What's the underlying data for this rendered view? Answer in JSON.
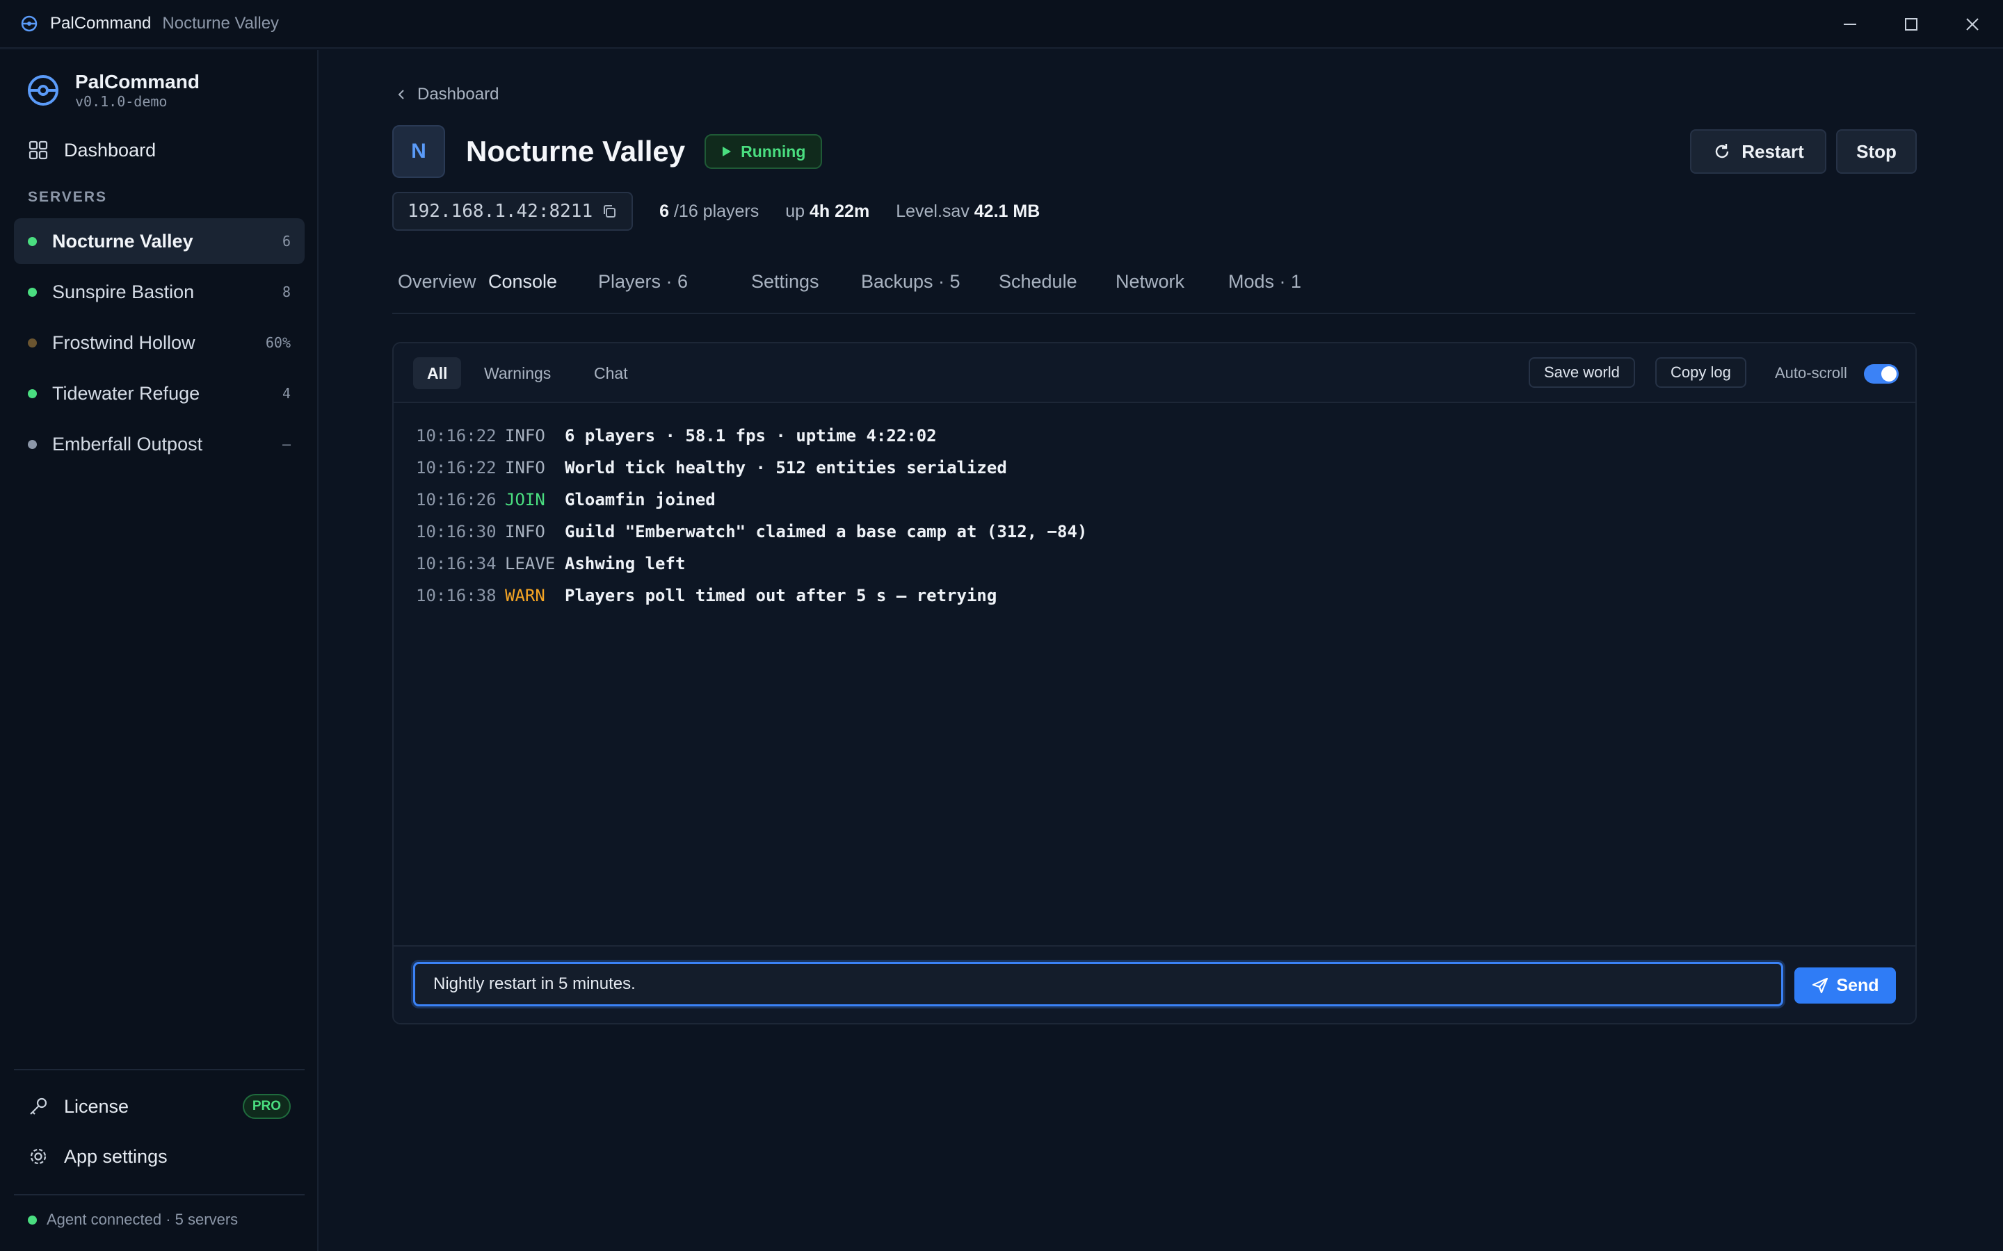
{
  "titlebar": {
    "app_name": "PalCommand",
    "window_name": "Nocturne Valley"
  },
  "sidebar": {
    "brand_name": "PalCommand",
    "version": "v0.1.0-demo",
    "dashboard_label": "Dashboard",
    "section_label": "SERVERS",
    "servers": [
      {
        "name": "Nocturne Valley",
        "count": "6",
        "status_color": "#4ade80",
        "active": true
      },
      {
        "name": "Sunspire Bastion",
        "count": "8",
        "status_color": "#4ade80",
        "active": false
      },
      {
        "name": "Frostwind Hollow",
        "count": "60%",
        "status_color": "#6b5530",
        "active": false
      },
      {
        "name": "Tidewater Refuge",
        "count": "4",
        "status_color": "#4ade80",
        "active": false
      },
      {
        "name": "Emberfall Outpost",
        "count": "–",
        "status_color": "#8c97a8",
        "active": false
      }
    ],
    "license_label": "License",
    "license_badge": "PRO",
    "settings_label": "App settings",
    "agent_status": "Agent connected · 5 servers"
  },
  "main": {
    "breadcrumb": "Dashboard",
    "avatar_letter": "N",
    "title": "Nocturne Valley",
    "status": "Running",
    "restart_label": "Restart",
    "stop_label": "Stop",
    "address": "192.168.1.42:8211",
    "players_current": "6",
    "players_max": "/16 players",
    "uptime_prefix": "up",
    "uptime": "4h 22m",
    "save_name": "Level.sav",
    "save_size": "42.1 MB",
    "tabs": [
      {
        "label": "Overview"
      },
      {
        "label": "Console"
      },
      {
        "label": "Players · 6"
      },
      {
        "label": "Settings"
      },
      {
        "label": "Backups · 5"
      },
      {
        "label": "Schedule"
      },
      {
        "label": "Network"
      },
      {
        "label": "Mods · 1"
      }
    ],
    "active_tab": "Console"
  },
  "console": {
    "filters": [
      "All",
      "Warnings",
      "Chat"
    ],
    "active_filter": "All",
    "save_world_label": "Save world",
    "copy_log_label": "Copy log",
    "autoscroll_label": "Auto-scroll",
    "autoscroll_on": true,
    "lines": [
      {
        "time": "10:16:22",
        "level": "INFO",
        "message": "6 players · 58.1 fps · uptime 4:22:02"
      },
      {
        "time": "10:16:22",
        "level": "INFO",
        "message": "World tick healthy · 512 entities serialized"
      },
      {
        "time": "10:16:26",
        "level": "JOIN",
        "message": "Gloamfin joined"
      },
      {
        "time": "10:16:30",
        "level": "INFO",
        "message": "Guild \"Emberwatch\" claimed a base camp at (312, −84)"
      },
      {
        "time": "10:16:34",
        "level": "LEAVE",
        "message": "Ashwing left"
      },
      {
        "time": "10:16:38",
        "level": "WARN",
        "message": "Players poll timed out after 5 s — retrying"
      }
    ],
    "level_colors": {
      "INFO": "#a9b3c1",
      "JOIN": "#4ade80",
      "LEAVE": "#a9b3c1",
      "WARN": "#f5a524"
    },
    "input_value": "Nightly restart in 5 minutes.",
    "send_label": "Send"
  },
  "colors": {
    "accent": "#3b82f6",
    "running": "#4ade80",
    "warning": "#f5a524"
  }
}
